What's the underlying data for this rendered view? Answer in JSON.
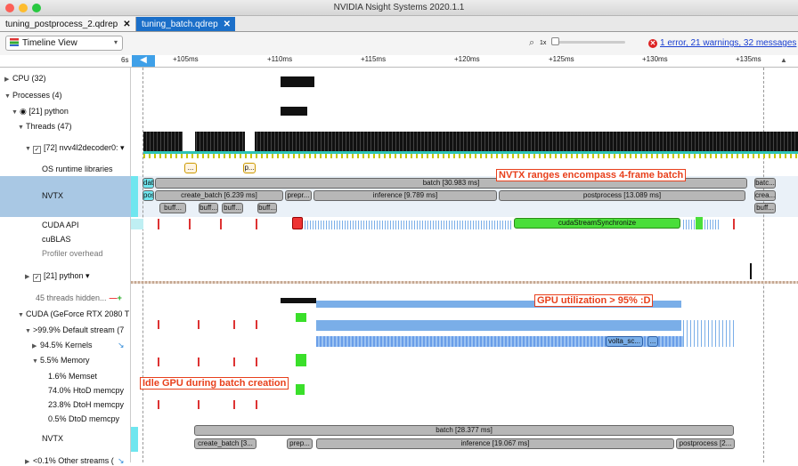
{
  "window": {
    "title": "NVIDIA Nsight Systems 2020.1.1"
  },
  "tabs": [
    {
      "label": "tuning_postprocess_2.qdrep",
      "active": false
    },
    {
      "label": "tuning_batch.qdrep",
      "active": true
    }
  ],
  "toolbar": {
    "view": "Timeline View",
    "zoom": "1x",
    "messages": "1 error, 21 warnings, 32 messages"
  },
  "ruler": {
    "start": "6s",
    "ticks": [
      "+105ms",
      "+110ms",
      "+115ms",
      "+120ms",
      "+125ms",
      "+130ms",
      "+135ms"
    ]
  },
  "tree": {
    "cpu": "CPU (32)",
    "processes": "Processes (4)",
    "python": "[21] python",
    "threads": "Threads (47)",
    "thread": "[72] nvv4l2decoder0: ▾",
    "os_runtime": "OS runtime libraries",
    "nvtx": "NVTX",
    "cuda_api": "CUDA API",
    "cublas": "cuBLAS",
    "profiler": "Profiler overhead",
    "python2": "[21] python ▾",
    "hidden": "45 threads hidden...",
    "cuda_gpu": "CUDA (GeForce RTX 2080 T",
    "default_stream": ">99.9% Default stream (7",
    "kernels": "94.5% Kernels",
    "memory": "5.5% Memory",
    "memset": "1.6% Memset",
    "htod": "74.0% HtoD memcpy",
    "dtoh": "23.8% DtoH memcpy",
    "dtod": "0.5% DtoD memcpy",
    "gpu_nvtx": "NVTX",
    "other_streams": "<0.1% Other streams ("
  },
  "nvtx_cpu": {
    "batch": "batch [30.983 ms]",
    "create_batch": "create_batch [6.239 ms]",
    "prepr": "prepr...",
    "inference": "inference [9.789 ms]",
    "postprocess": "postprocess [13.089 ms]",
    "buff": "buff...",
    "left1": "data...",
    "left2": "post...",
    "right1": "batc...",
    "right2": "crea...",
    "right3": "buff...",
    "os_p": "p...",
    "os_dots": "..."
  },
  "cuda_api_bar": "cudaStreamSynchronize",
  "kernel_label": "volta_sc...",
  "kernel_dots": "...",
  "nvtx_gpu": {
    "batch": "batch [28.377 ms]",
    "create_batch": "create_batch [3...",
    "prepr": "prep...",
    "inference": "inference [19.067 ms]",
    "postprocess": "postprocess [2..."
  },
  "annotations": {
    "nvtx": "NVTX ranges encompass 4-frame batch",
    "gpu": "GPU utilization > 95% :D",
    "idle": "Idle GPU during batch creation"
  },
  "colors": {
    "accent": "#1b6fc9",
    "annotation": "#e8401c",
    "selection": "#a9c8e4"
  }
}
